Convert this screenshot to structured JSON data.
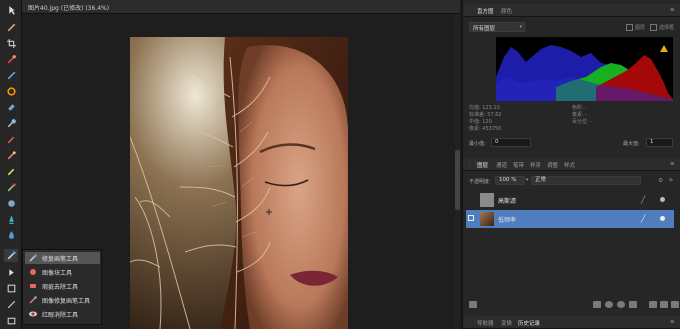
{
  "document": {
    "title": "图片40.jpg (已修改) (36.4%)",
    "close_glyph": "×"
  },
  "tools": [
    "move-tool-icon",
    "brush-icon",
    "crop-icon",
    "color-picker-icon",
    "pen-icon",
    "fill-icon",
    "eraser-icon",
    "selection-brush-icon",
    "clone-icon",
    "dodge-icon",
    "burn-icon",
    "smudge-icon",
    "sponge-icon",
    "sharpen-icon",
    "paint-mixer-icon",
    "healing-brush-icon",
    "text-icon",
    "shape-icon",
    "rectangle-icon",
    "zoom-icon"
  ],
  "tool_popup": {
    "items": [
      {
        "label": "修复画笔工具",
        "icon": "healing-brush-icon",
        "selected": true
      },
      {
        "label": "图像块工具",
        "icon": "patch-icon",
        "selected": false
      },
      {
        "label": "瑕疵去除工具",
        "icon": "blemish-icon",
        "selected": false
      },
      {
        "label": "图像修复画笔工具",
        "icon": "inpainting-icon",
        "selected": false
      },
      {
        "label": "红眼消除工具",
        "icon": "red-eye-icon",
        "selected": false
      }
    ]
  },
  "histogram_panel": {
    "tabs": [
      "直方图",
      "颜色"
    ],
    "source_select": "所有图层",
    "check_layer": "图层",
    "check_selection": "选择框",
    "warning_icon": "warning-icon",
    "stats_left": [
      "均值: 123.10",
      "标准差: 57.62",
      "中值: 120",
      "像素: 453750"
    ],
    "stats_right": [
      "色阶: -",
      "像素: -",
      "百分位: -"
    ],
    "min_label": "最小值:",
    "min_value": "0",
    "max_label": "最大值:",
    "max_value": "1",
    "colors": {
      "blue": "#1d1daa",
      "green": "#17b020",
      "red": "#a40808",
      "bg": "#000000"
    }
  },
  "layers_panel": {
    "tabs": [
      "图层",
      "通道",
      "笔带",
      "样序",
      "调整",
      "样式"
    ],
    "opacity_label": "不透明度:",
    "opacity_value": "100 %",
    "blend_mode": "正常",
    "layers": [
      {
        "name": "高斯滤",
        "selected": false
      },
      {
        "name": "低频率",
        "selected": true
      }
    ]
  },
  "bottom_panel": {
    "tabs": [
      "导航器",
      "变换",
      "历史记录"
    ]
  }
}
